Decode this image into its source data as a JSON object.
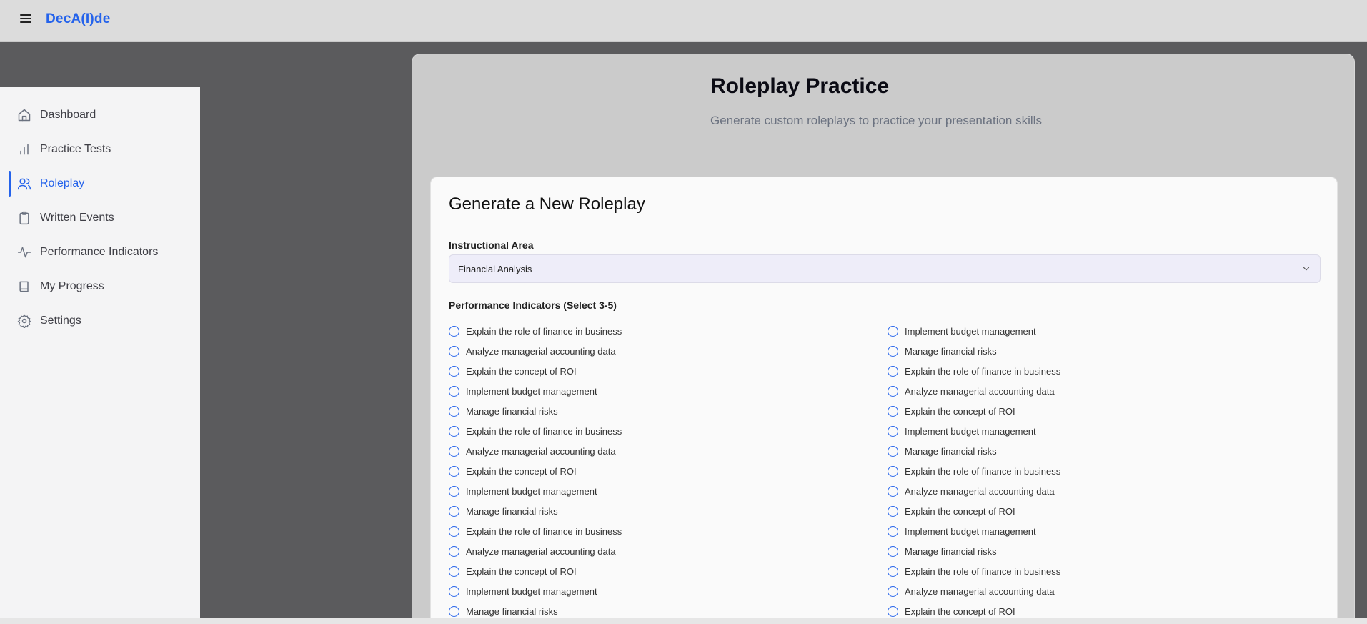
{
  "app": {
    "brand": "DecA(I)de"
  },
  "sidebar": {
    "items": [
      {
        "label": "Dashboard",
        "icon": "home-icon",
        "active": false
      },
      {
        "label": "Practice Tests",
        "icon": "bar-chart-icon",
        "active": false
      },
      {
        "label": "Roleplay",
        "icon": "users-icon",
        "active": true
      },
      {
        "label": "Written Events",
        "icon": "clipboard-icon",
        "active": false
      },
      {
        "label": "Performance Indicators",
        "icon": "activity-icon",
        "active": false
      },
      {
        "label": "My Progress",
        "icon": "book-icon",
        "active": false
      },
      {
        "label": "Settings",
        "icon": "gear-icon",
        "active": false
      }
    ]
  },
  "page": {
    "title": "Roleplay Practice",
    "subtitle": "Generate custom roleplays to practice your presentation skills"
  },
  "form": {
    "card_title": "Generate a New Roleplay",
    "instructional_area_label": "Instructional Area",
    "instructional_area_value": "Financial Analysis",
    "performance_indicators_label": "Performance Indicators (Select 3-5)",
    "left_column": [
      "Explain the role of finance in business",
      "Analyze managerial accounting data",
      "Explain the concept of ROI",
      "Implement budget management",
      "Manage financial risks",
      "Explain the role of finance in business",
      "Analyze managerial accounting data",
      "Explain the concept of ROI",
      "Implement budget management",
      "Manage financial risks",
      "Explain the role of finance in business",
      "Analyze managerial accounting data",
      "Explain the concept of ROI",
      "Implement budget management",
      "Manage financial risks"
    ],
    "right_column": [
      "Implement budget management",
      "Manage financial risks",
      "Explain the role of finance in business",
      "Analyze managerial accounting data",
      "Explain the concept of ROI",
      "Implement budget management",
      "Manage financial risks",
      "Explain the role of finance in business",
      "Analyze managerial accounting data",
      "Explain the concept of ROI",
      "Implement budget management",
      "Manage financial risks",
      "Explain the role of finance in business",
      "Analyze managerial accounting data",
      "Explain the concept of ROI"
    ]
  },
  "colors": {
    "accent": "#2563eb",
    "sidebar_bg": "#f4f4f5",
    "overlay": "#5b5b5d"
  }
}
